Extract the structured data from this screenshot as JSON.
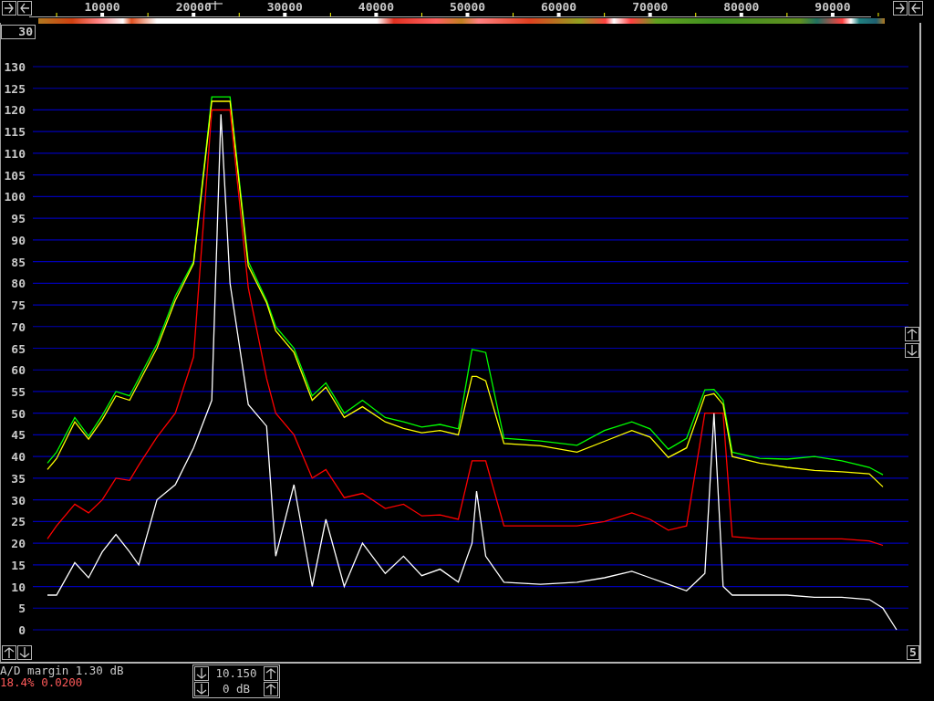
{
  "left_scale_button": {
    "label": "30"
  },
  "chart_data": {
    "type": "line",
    "xlim": [
      2400,
      98300
    ],
    "ylim": [
      0,
      130
    ],
    "grid": true,
    "xticks": [
      10000,
      20000,
      30000,
      40000,
      50000,
      60000,
      70000,
      80000,
      90000
    ],
    "yticks": [
      0,
      5,
      10,
      15,
      20,
      25,
      30,
      35,
      40,
      45,
      50,
      55,
      60,
      65,
      70,
      75,
      80,
      85,
      90,
      95,
      100,
      105,
      110,
      115,
      120,
      125,
      130
    ],
    "x": [
      4000,
      5000,
      7000,
      8500,
      10000,
      11500,
      13000,
      14000,
      16000,
      18000,
      20000,
      22000,
      23000,
      24000,
      26000,
      28000,
      29000,
      31000,
      33000,
      34500,
      36500,
      38500,
      41000,
      43000,
      45000,
      47000,
      49000,
      50500,
      51000,
      52000,
      54000,
      58000,
      62000,
      65000,
      68000,
      70000,
      72000,
      74000,
      76000,
      77000,
      78000,
      79000,
      82000,
      85000,
      88000,
      91000,
      94000,
      95500,
      97000
    ],
    "series": [
      {
        "color": "#00ff00",
        "values": [
          38.5,
          41,
          49,
          44.7,
          49.5,
          55,
          54,
          58,
          66,
          77,
          85,
          123,
          123,
          123,
          85,
          76,
          70,
          65,
          54,
          57,
          50,
          53,
          49,
          48,
          46.8,
          47.4,
          46.4,
          64.7,
          64.5,
          64,
          44.2,
          43.6,
          42.6,
          46,
          48,
          46.4,
          41.7,
          44.2,
          55.4,
          55.5,
          53,
          41,
          39.6,
          39.4,
          40,
          39,
          37.5,
          35.8,
          null
        ]
      },
      {
        "color": "#ffff00",
        "values": [
          37,
          39.5,
          48,
          44,
          48.5,
          54,
          53,
          57,
          65,
          76,
          84.5,
          122,
          122,
          122,
          84,
          75.5,
          69,
          64,
          53,
          56,
          49,
          51.5,
          48,
          46.5,
          45.5,
          46,
          45,
          58.5,
          58.5,
          57.5,
          43,
          42.5,
          41,
          43.5,
          46,
          44.5,
          39.8,
          42,
          54,
          54.5,
          52,
          40,
          38.5,
          37.5,
          36.8,
          36.5,
          36,
          33,
          null
        ]
      },
      {
        "color": "#ff0000",
        "values": [
          21,
          24,
          29,
          27,
          30,
          35,
          34.5,
          38,
          44.5,
          50,
          63,
          120,
          120,
          120,
          79,
          58,
          50,
          45,
          35,
          37,
          30.5,
          31.5,
          28,
          29,
          26.3,
          26.5,
          25.5,
          39,
          39,
          39,
          24,
          24,
          24,
          25,
          27,
          25.5,
          23,
          24,
          50,
          50,
          50,
          21.5,
          21,
          21,
          21,
          21,
          20.5,
          19.5,
          null
        ]
      },
      {
        "color": "#ffffff",
        "values": [
          8,
          8,
          15.5,
          12,
          18,
          22,
          18,
          15,
          30,
          33.5,
          42,
          53,
          119,
          80,
          52,
          47,
          17,
          33.5,
          10,
          25.5,
          10,
          20,
          13,
          17,
          12.5,
          14,
          11,
          20,
          32,
          17,
          11,
          10.5,
          11,
          12,
          13.5,
          12,
          10.5,
          9,
          13,
          50,
          10,
          8,
          8,
          8,
          7.5,
          7.5,
          7,
          5,
          0
        ]
      }
    ]
  },
  "right_scale_button": {
    "label": "5"
  },
  "status": {
    "ad_margin": "A/D margin 1.30 dB",
    "level_readout": "18.4% 0.0200"
  },
  "spinners": [
    {
      "value": "10.150"
    },
    {
      "value": "0 dB"
    }
  ]
}
